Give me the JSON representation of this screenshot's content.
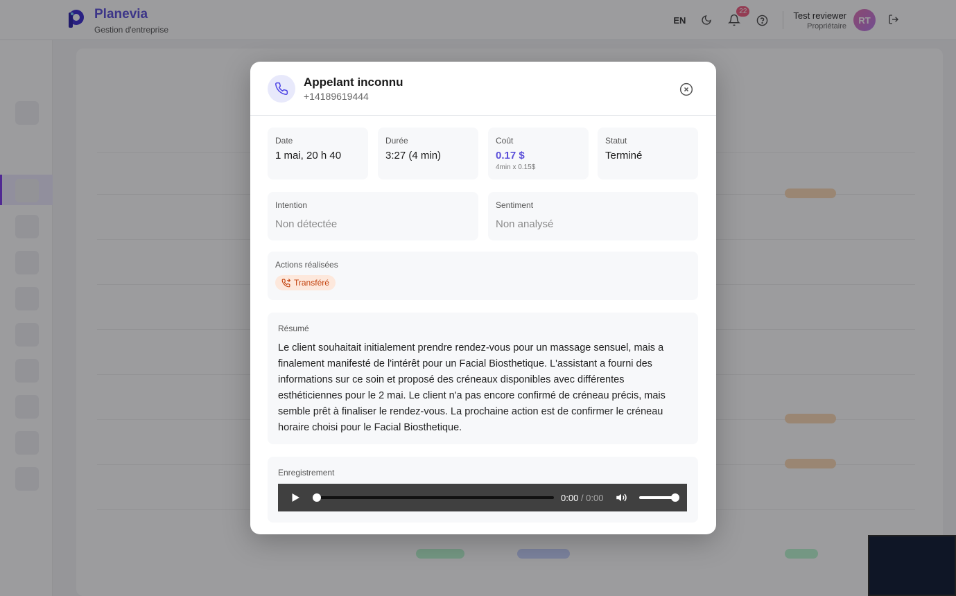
{
  "header": {
    "brand_name": "Planevia",
    "brand_subtitle": "Gestion d'entreprise",
    "language": "EN",
    "notification_count": "22",
    "user_name": "Test reviewer",
    "user_role": "Propriétaire",
    "user_initials": "RT"
  },
  "modal": {
    "caller_name": "Appelant inconnu",
    "caller_number": "+14189619444",
    "date_label": "Date",
    "date_value": "1 mai, 20 h 40",
    "duration_label": "Durée",
    "duration_value": "3:27 (4 min)",
    "cost_label": "Coût",
    "cost_value": "0.17 $",
    "cost_detail": "4min x 0.15$",
    "status_label": "Statut",
    "status_value": "Terminé",
    "intent_label": "Intention",
    "intent_value": "Non détectée",
    "sentiment_label": "Sentiment",
    "sentiment_value": "Non analysé",
    "actions_label": "Actions réalisées",
    "action_tag": "Transféré",
    "summary_label": "Résumé",
    "summary_text": "Le client souhaitait initialement prendre rendez-vous pour un massage sensuel, mais a finalement manifesté de l'intérêt pour un Facial Biosthetique. L'assistant a fourni des informations sur ce soin et proposé des créneaux disponibles avec différentes esthéticiennes pour le 2 mai. Le client n'a pas encore confirmé de créneau précis, mais semble prêt à finaliser le rendez-vous. La prochaine action est de confirmer le créneau horaire choisi pour le Facial Biosthetique.",
    "recording_label": "Enregistrement",
    "player_current": "0:00",
    "player_total": "0:00",
    "player_progress": 0,
    "player_volume": 1.0
  },
  "colors": {
    "brand": "#5b4fd9",
    "tag_bg": "#fde8dc",
    "tag_text": "#c2410c",
    "notification_badge": "#f05a7e"
  }
}
